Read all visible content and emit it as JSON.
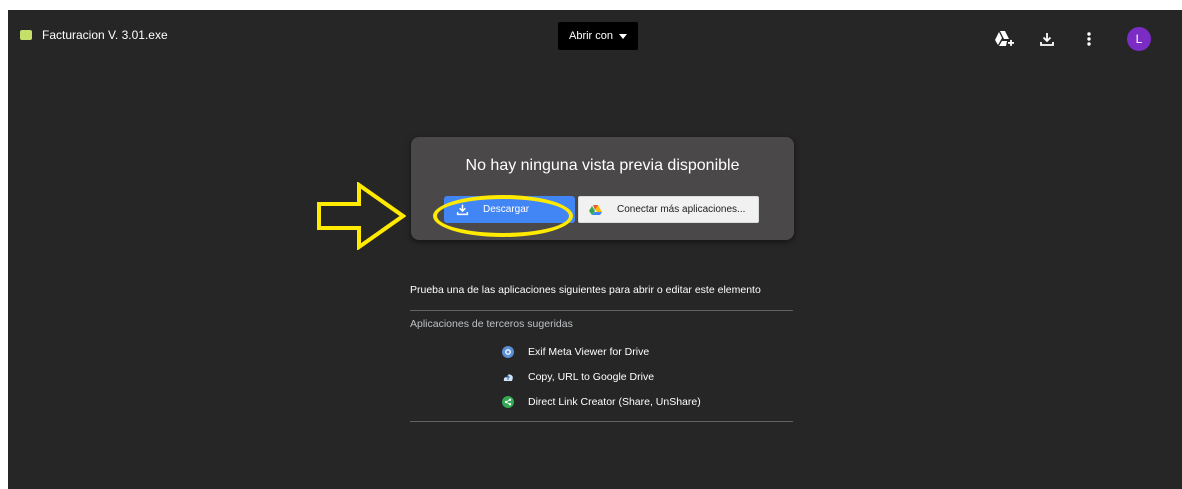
{
  "topbar": {
    "file_name": "Facturacion V. 3.01.exe",
    "file_icon": "file-icon",
    "open_with_label": "Abrir con",
    "actions": [
      "add-to-drive-icon",
      "download-icon",
      "more-vert-icon"
    ],
    "avatar_letter": "L",
    "avatar_color": "#7b2cc5"
  },
  "preview": {
    "title": "No hay ninguna vista previa disponible",
    "download_label": "Descargar",
    "connect_label": "Conectar más aplicaciones..."
  },
  "suggestions": {
    "prompt": "Prueba una de las aplicaciones siguientes para abrir o editar este elemento",
    "section_label": "Aplicaciones de terceros sugeridas",
    "apps": [
      {
        "name": "Exif Meta Viewer for Drive",
        "icon": "camera-icon",
        "color": "#5b8fd6"
      },
      {
        "name": "Copy, URL to Google Drive",
        "icon": "cloud-upload-icon",
        "color": "#d0e4f5"
      },
      {
        "name": "Direct Link Creator (Share, UnShare)",
        "icon": "share-icon",
        "color": "#34a853"
      }
    ]
  },
  "colors": {
    "background": "#262626",
    "card": "#4a4849",
    "accent_blue": "#4285f4",
    "annotation_yellow": "#ffea00"
  }
}
